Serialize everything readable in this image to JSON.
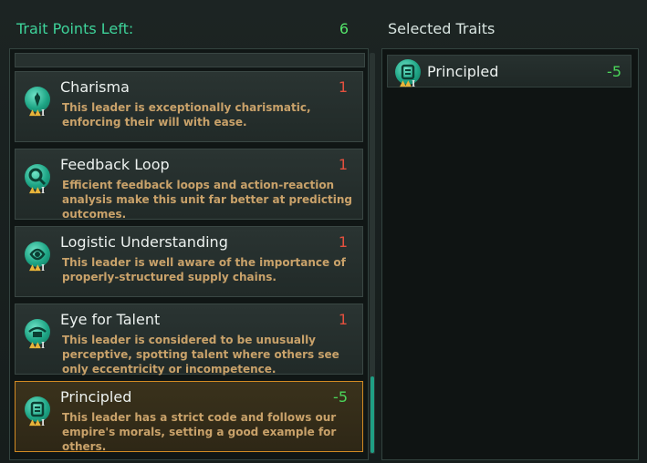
{
  "header": {
    "points_label": "Trait Points Left:",
    "points_value": "6",
    "selected_title": "Selected Traits"
  },
  "traits": [
    {
      "title": "Charisma",
      "cost": "1",
      "rank": "I",
      "icon": "charisma-icon",
      "description": "This leader is exceptionally charismatic, enforcing their will with ease."
    },
    {
      "title": "Feedback Loop",
      "cost": "1",
      "rank": "I",
      "icon": "feedback-loop-icon",
      "description": "Efficient feedback loops and action-reaction analysis make this unit far better at predicting outcomes."
    },
    {
      "title": "Logistic Understanding",
      "cost": "1",
      "rank": "I",
      "icon": "logistics-icon",
      "description": "This leader is well aware of the importance of properly-structured supply chains."
    },
    {
      "title": "Eye for Talent",
      "cost": "1",
      "rank": "I",
      "icon": "eye-icon",
      "description": "This leader is considered to be unusually perceptive, spotting talent where others see only eccentricity or incompetence."
    },
    {
      "title": "Principled",
      "cost": "-5",
      "rank": "I",
      "icon": "principled-icon",
      "description": "This leader has a strict code and follows our empire's morals, setting a good example for others."
    }
  ],
  "selected": [
    {
      "title": "Principled",
      "cost": "-5",
      "rank": "I",
      "icon": "principled-icon"
    }
  ],
  "colors": {
    "accent": "#3ed39a",
    "positive_cost": "#4bd65a",
    "cost": "#e3503e",
    "selected_border": "#d28a23",
    "description": "#c9a26a"
  }
}
